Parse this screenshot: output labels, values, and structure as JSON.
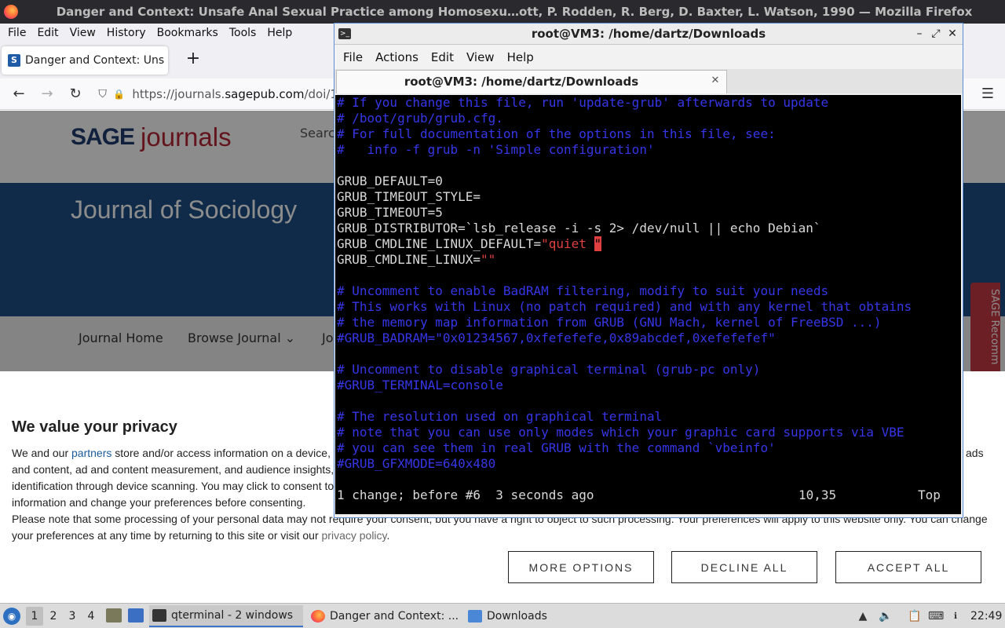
{
  "firefox": {
    "window_title": "Danger and Context: Unsafe Anal Sexual Practice among Homosexu…ott, P. Rodden, R. Berg, D. Baxter, L. Watson, 1990 — Mozilla Firefox",
    "menu": [
      "File",
      "Edit",
      "View",
      "History",
      "Bookmarks",
      "Tools",
      "Help"
    ],
    "tab_title": "Danger and Context: Uns",
    "tab_favicon": "S",
    "new_tab": "+",
    "url_prefix": "https://journals.",
    "url_domain": "sagepub.com",
    "url_suffix": "/doi/1",
    "icons": {
      "back": "←",
      "forward": "→",
      "reload": "↻",
      "shield": "⛉",
      "lock": "🔒",
      "menu": "☰"
    }
  },
  "page": {
    "logo_sage": "SAGE",
    "logo_journals": "journals",
    "search_text": "Searc",
    "journal_title": "Journal of Sociology",
    "nav": [
      "Journal Home",
      "Browse Journal",
      "Jo"
    ],
    "nav_chevron": "⌄",
    "recommends": "SAGE Recomm",
    "privacy": {
      "title": "We value your privacy",
      "p1_a": "We and our ",
      "p1_link": "partners",
      "p1_b": " store and/or access information on a device,",
      "p1_right": "ads",
      "line2": "and content, ad and content measurement, and audience insights,",
      "line3": "identification through device scanning. You may click to consent to",
      "line4": "information and change your preferences before consenting.",
      "line5": "Please note that some processing of your personal data may not require your consent, but you have a right to object to such processing. Your preferences will apply to this website only. You can change",
      "line6_a": "your preferences at any time by returning to this site or visit our ",
      "line6_link": "privacy policy",
      "line6_b": ".",
      "btn_more": "MORE OPTIONS",
      "btn_decline": "DECLINE ALL",
      "btn_accept": "ACCEPT ALL"
    }
  },
  "terminal": {
    "window_title": "root@VM3: /home/dartz/Downloads",
    "menu": [
      "File",
      "Actions",
      "Edit",
      "View",
      "Help"
    ],
    "tab_label": "root@VM3: /home/dartz/Downloads",
    "controls": {
      "minimize": "–",
      "maximize": "⤢",
      "close": "✕",
      "tab_close": "✕"
    },
    "lines": {
      "l1": "# If you change this file, run 'update-grub' afterwards to update",
      "l2": "# /boot/grub/grub.cfg.",
      "l3": "# For full documentation of the options in this file, see:",
      "l4": "#   info -f grub -n 'Simple configuration'",
      "l6": "GRUB_DEFAULT=0",
      "l7": "GRUB_TIMEOUT_STYLE=",
      "l8": "GRUB_TIMEOUT=5",
      "l9": "GRUB_DISTRIBUTOR=`lsb_release -i -s 2> /dev/null || echo Debian`",
      "l10_key": "GRUB_CMDLINE_LINUX_DEFAULT=",
      "l10_val": "\"quiet ",
      "l10_cursor": "\"",
      "l11_key": "GRUB_CMDLINE_LINUX=",
      "l11_val": "\"\"",
      "l13": "# Uncomment to enable BadRAM filtering, modify to suit your needs",
      "l14": "# This works with Linux (no patch required) and with any kernel that obtains",
      "l15": "# the memory map information from GRUB (GNU Mach, kernel of FreeBSD ...)",
      "l16": "#GRUB_BADRAM=\"0x01234567,0xfefefefe,0x89abcdef,0xefefefef\"",
      "l18": "# Uncomment to disable graphical terminal (grub-pc only)",
      "l19": "#GRUB_TERMINAL=console",
      "l21": "# The resolution used on graphical terminal",
      "l22": "# note that you can use only modes which your graphic card supports via VBE",
      "l23": "# you can see them in real GRUB with the command `vbeinfo'",
      "l24": "#GRUB_GFXMODE=640x480"
    },
    "status_msg": "1 change; before #6  3 seconds ago",
    "status_pos": "10,35",
    "status_scroll": "Top"
  },
  "taskbar": {
    "workspaces": [
      "1",
      "2",
      "3",
      "4"
    ],
    "active_workspace": "1",
    "task_terminal": "qterminal - 2 windows",
    "task_firefox": "Danger and Context: ...",
    "task_files": "Downloads",
    "clock": "22:49"
  }
}
